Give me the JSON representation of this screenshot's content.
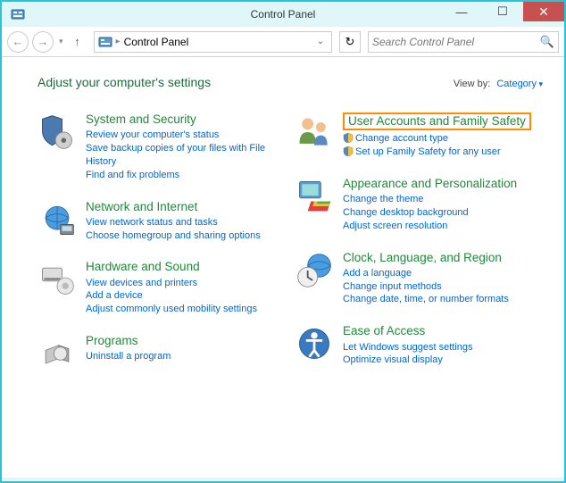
{
  "window": {
    "title": "Control Panel"
  },
  "toolbar": {
    "address": "Control Panel",
    "search_placeholder": "Search Control Panel"
  },
  "header": {
    "heading": "Adjust your computer's settings",
    "viewby_label": "View by:",
    "viewby_value": "Category"
  },
  "left_categories": [
    {
      "title": "System and Security",
      "links": [
        "Review your computer's status",
        "Save backup copies of your files with File History",
        "Find and fix problems"
      ]
    },
    {
      "title": "Network and Internet",
      "links": [
        "View network status and tasks",
        "Choose homegroup and sharing options"
      ]
    },
    {
      "title": "Hardware and Sound",
      "links": [
        "View devices and printers",
        "Add a device",
        "Adjust commonly used mobility settings"
      ]
    },
    {
      "title": "Programs",
      "links": [
        "Uninstall a program"
      ]
    }
  ],
  "right_categories": [
    {
      "title": "User Accounts and Family Safety",
      "highlighted": true,
      "links_shielded": [
        "Change account type",
        "Set up Family Safety for any user"
      ]
    },
    {
      "title": "Appearance and Personalization",
      "links": [
        "Change the theme",
        "Change desktop background",
        "Adjust screen resolution"
      ]
    },
    {
      "title": "Clock, Language, and Region",
      "links": [
        "Add a language",
        "Change input methods",
        "Change date, time, or number formats"
      ]
    },
    {
      "title": "Ease of Access",
      "links": [
        "Let Windows suggest settings",
        "Optimize visual display"
      ]
    }
  ]
}
